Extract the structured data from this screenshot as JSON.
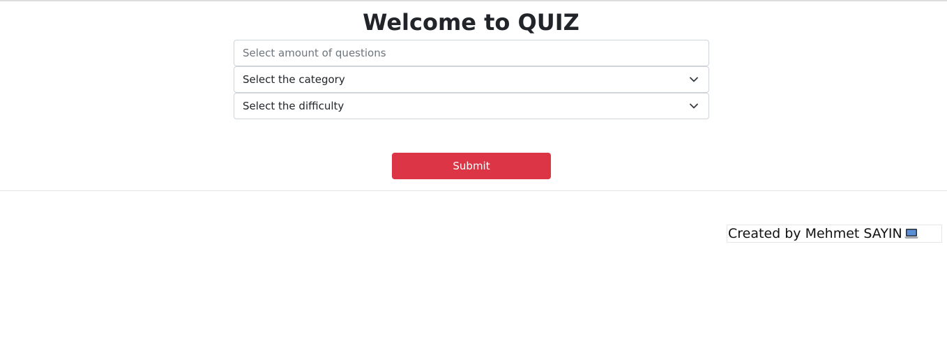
{
  "page": {
    "title": "Welcome to QUIZ"
  },
  "form": {
    "amount": {
      "placeholder": "Select amount of questions",
      "value": ""
    },
    "category": {
      "selected": "Select the category",
      "icon": "chevron-down-icon"
    },
    "difficulty": {
      "selected": "Select the difficulty",
      "icon": "chevron-down-icon"
    },
    "submit_label": "Submit"
  },
  "footer": {
    "credit": "Created by Mehmet SAYIN",
    "icon": "laptop-icon"
  },
  "colors": {
    "accent": "#dc3545",
    "border": "#ced4da",
    "text": "#212529",
    "placeholder": "#6c757d"
  }
}
